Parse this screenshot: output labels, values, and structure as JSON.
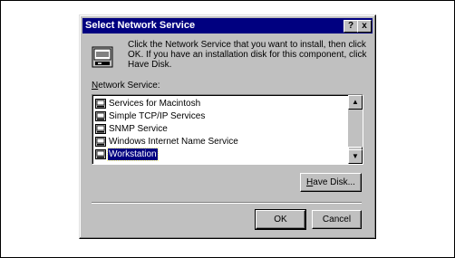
{
  "dialog": {
    "title": "Select Network Service",
    "help_button": "?",
    "close_button": "x",
    "instructions": "Click the Network Service that you want to install, then click OK.  If you have an installation disk for this component, click Have Disk.",
    "list_label_accel": "N",
    "list_label_rest": "etwork Service:",
    "services": [
      "Services for Macintosh",
      "Simple TCP/IP Services",
      "SNMP Service",
      "Windows Internet Name Service",
      "Workstation"
    ],
    "selected_service": "Workstation",
    "have_disk_accel": "H",
    "have_disk_rest": "ave Disk...",
    "ok_label": "OK",
    "cancel_label": "Cancel"
  },
  "colors": {
    "title_bar": "#000080",
    "dialog_face": "#c0c0c0",
    "selection": "#000080"
  }
}
